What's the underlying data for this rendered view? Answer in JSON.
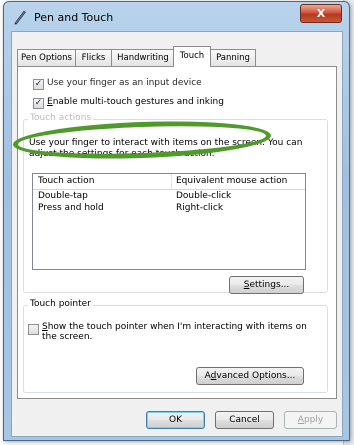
{
  "window": {
    "title": "Pen and Touch",
    "close_label": "X"
  },
  "tabs": [
    {
      "label": "Pen Options",
      "active": false
    },
    {
      "label": "Flicks",
      "active": false
    },
    {
      "label": "Handwriting",
      "active": false
    },
    {
      "label": "Touch",
      "active": true
    },
    {
      "label": "Panning",
      "active": false
    }
  ],
  "touch": {
    "use_finger": {
      "label": "Use your finger as an input device",
      "checked": true
    },
    "multitouch": {
      "label_pre": "",
      "label_accel": "E",
      "label_post": "nable multi-touch gestures and inking",
      "checked": true
    },
    "touch_actions": {
      "legend": "Touch actions",
      "description": "Use your finger to interact with items on the screen. You can adjust the settings for each touch action.",
      "columns": [
        "Touch action",
        "Equivalent mouse action"
      ],
      "rows": [
        {
          "action": "Double-tap",
          "mouse": "Double-click"
        },
        {
          "action": "Press and hold",
          "mouse": "Right-click"
        }
      ],
      "settings_button": {
        "accel": "S",
        "rest": "ettings..."
      }
    },
    "pointer": {
      "legend": "Touch pointer",
      "checkbox": {
        "pre": "",
        "accel": "S",
        "post": "how the touch pointer when I'm interacting with items on the screen.",
        "checked": false
      },
      "advanced_button": {
        "pre": "A",
        "accel": "d",
        "post": "vanced Options..."
      }
    }
  },
  "footer": {
    "ok": "OK",
    "cancel": "Cancel",
    "apply_pre": "",
    "apply_accel": "A",
    "apply_post": "pply"
  },
  "colors": {
    "highlight_ring": "#4f9a2b",
    "title_gradient_top": "#b9d3ec",
    "close_red": "#c9573a"
  }
}
